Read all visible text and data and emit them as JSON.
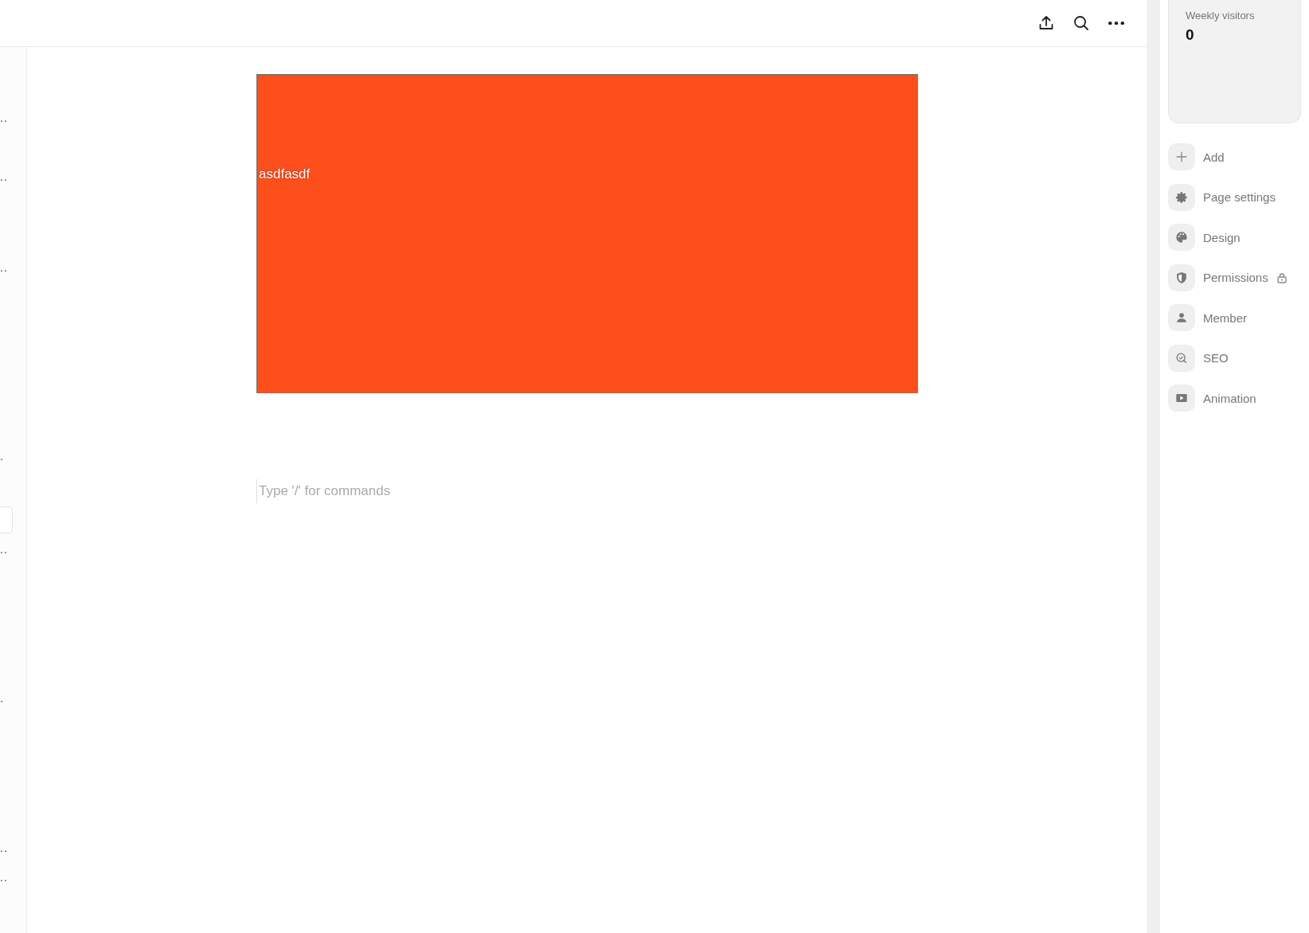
{
  "left_sidebar": {
    "items": [
      {
        "text": ".."
      },
      {
        "text": ".."
      },
      {
        "text": ".."
      },
      {
        "text": "."
      },
      {
        "text": ".."
      },
      {
        "text": "."
      },
      {
        "text": ".."
      },
      {
        "text": ".."
      }
    ]
  },
  "cover_block": {
    "text": "asdfasdf"
  },
  "editor": {
    "placeholder": "Type '/' for commands"
  },
  "stats_card": {
    "label": "Weekly visitors",
    "value": "0"
  },
  "menu": [
    {
      "label": "Add",
      "locked": false
    },
    {
      "label": "Page settings",
      "locked": false
    },
    {
      "label": "Design",
      "locked": false
    },
    {
      "label": "Permissions",
      "locked": true
    },
    {
      "label": "Member",
      "locked": false
    },
    {
      "label": "SEO",
      "locked": false
    },
    {
      "label": "Animation",
      "locked": false
    }
  ]
}
